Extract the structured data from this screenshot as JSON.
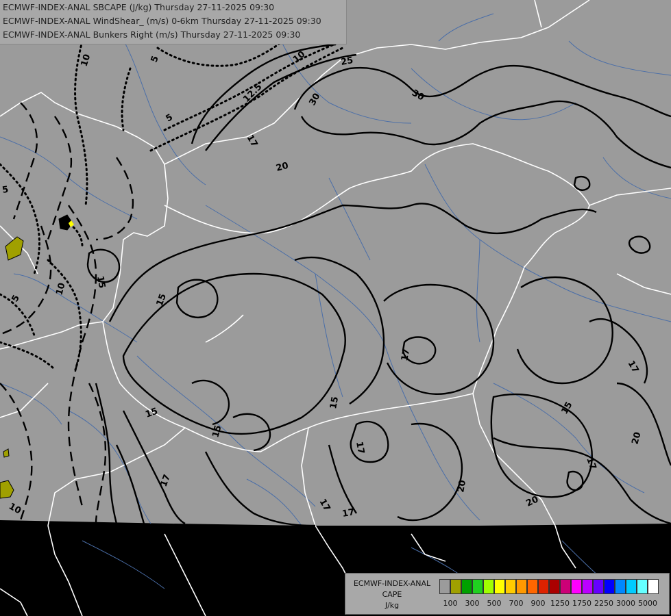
{
  "header": {
    "line1": "ECMWF-INDEX-ANAL SBCAPE (J/kg) Thursday 27-11-2025 09:30",
    "line2": "ECMWF-INDEX-ANAL WindShear_ (m/s) 0-6km Thursday 27-11-2025 09:30",
    "line3": "ECMWF-INDEX-ANAL Bunkers Right (m/s) Thursday 27-11-2025 09:30"
  },
  "legend": {
    "line1": "ECMWF-INDEX-ANAL",
    "line2": "CAPE",
    "line3": "J/kg",
    "swatches": [
      {
        "color": "#9b9b9b"
      },
      {
        "color": "#a0a000"
      },
      {
        "color": "#00a000"
      },
      {
        "color": "#20d020"
      },
      {
        "color": "#a0ff00"
      },
      {
        "color": "#ffff00"
      },
      {
        "color": "#ffcc00"
      },
      {
        "color": "#ff9900"
      },
      {
        "color": "#ff6600"
      },
      {
        "color": "#dd2200"
      },
      {
        "color": "#aa0000"
      },
      {
        "color": "#cc0077"
      },
      {
        "color": "#ff00ff"
      },
      {
        "color": "#bb00ff"
      },
      {
        "color": "#6600ff"
      },
      {
        "color": "#0000ff"
      },
      {
        "color": "#0088ff"
      },
      {
        "color": "#00ccff"
      },
      {
        "color": "#66ffff"
      },
      {
        "color": "#ffffff"
      }
    ],
    "ticks": [
      "100",
      "300",
      "500",
      "700",
      "900",
      "1250",
      "1750",
      "2250",
      "3000",
      "5000"
    ]
  },
  "contour_labels": {
    "l10a": "10",
    "l5a": "5",
    "l25": "25",
    "l30": "30",
    "l30b": "30",
    "l20a": "20",
    "l17a": "17",
    "l17b": "17",
    "l15a": "15",
    "l15b": "15",
    "l15c": "15",
    "l15d": "15",
    "l15e": "15",
    "l15f": "15",
    "l17c": "17",
    "l17d": "17",
    "l17e": "17",
    "l17f": "17",
    "l17g": "17",
    "l17h": "17",
    "l20b": "20",
    "l20c": "20",
    "l20d": "20",
    "l10b": "10",
    "l10c": "10",
    "l5b": "5",
    "l5c": "5",
    "l5d": "5",
    "l125": "12.5",
    "l10d": "10"
  },
  "colors": {
    "data_area": "#9b9b9b",
    "outside": "#000000",
    "borders": "#ffffff",
    "rivers": "#4a6ea8",
    "contours": "#000000",
    "cape_100": "#a0a000"
  }
}
